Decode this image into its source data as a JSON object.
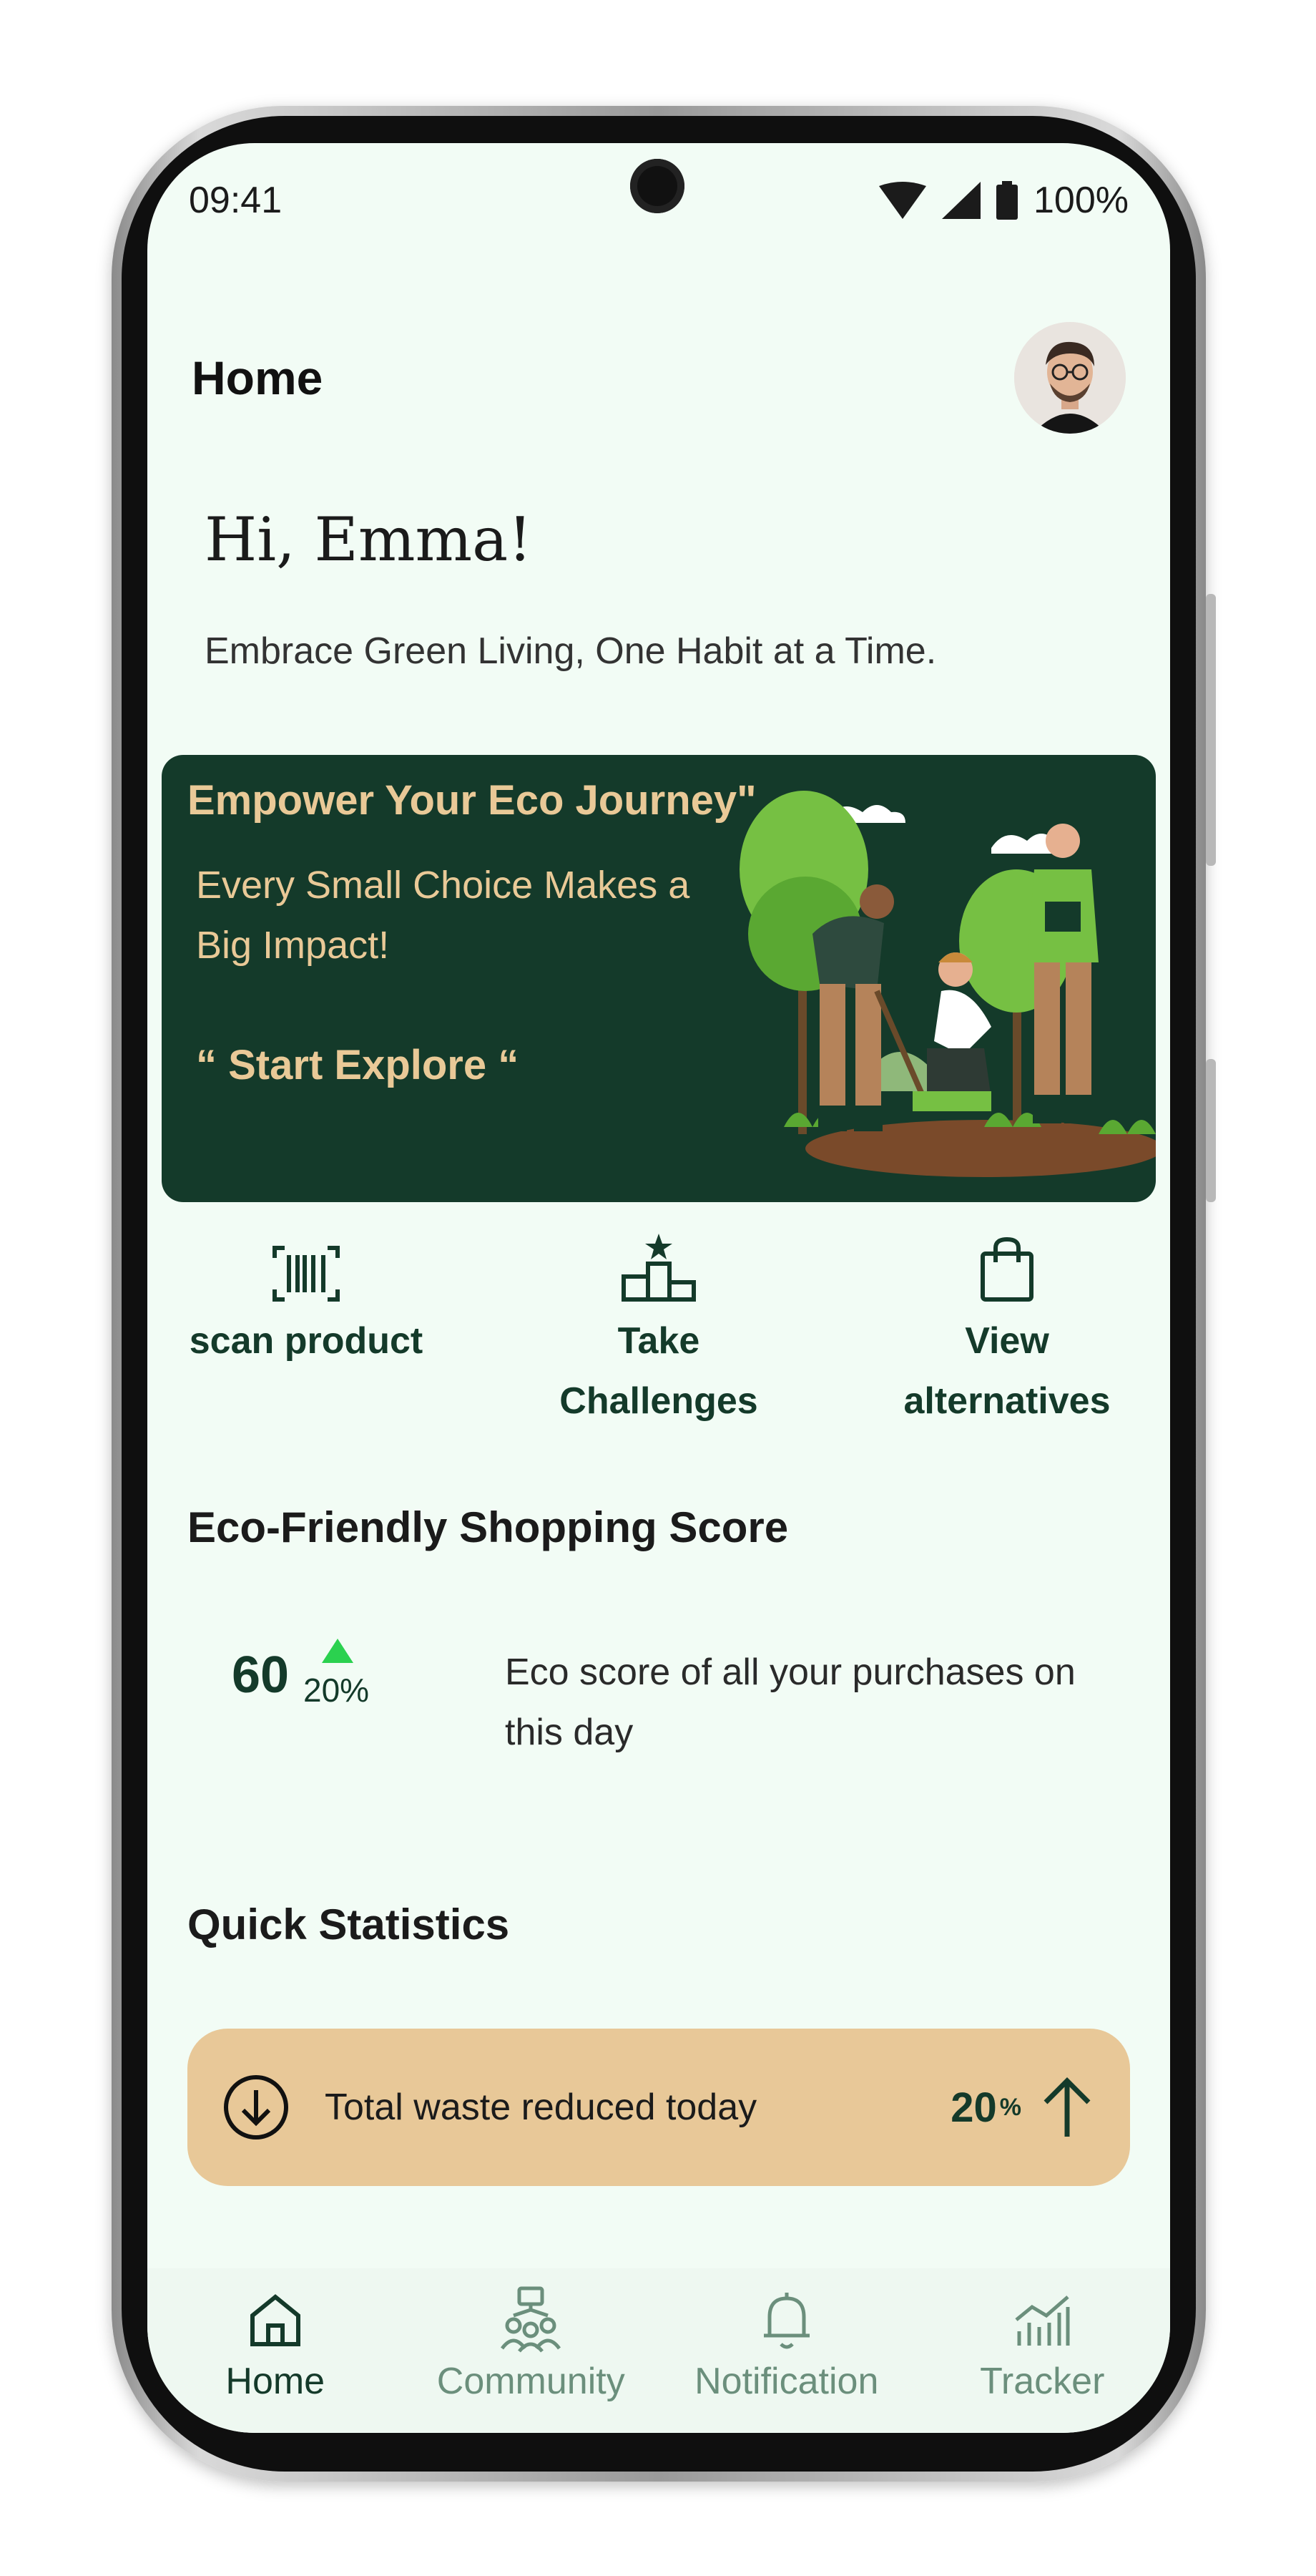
{
  "status_bar": {
    "time": "09:41",
    "battery": "100%"
  },
  "header": {
    "title": "Home"
  },
  "greeting": {
    "text": "Hi, Emma!",
    "tagline": "Embrace Green Living, One Habit at a Time."
  },
  "banner": {
    "title": "Empower Your Eco Journey\"",
    "subtitle": "Every Small Choice Makes a Big Impact!",
    "cta": "“ Start Explore “"
  },
  "quick_actions": [
    {
      "label": "scan product",
      "icon": "barcode-icon"
    },
    {
      "label": "Take Challenges",
      "icon": "podium-icon"
    },
    {
      "label": "View alternatives",
      "icon": "shopping-bag-icon"
    }
  ],
  "score": {
    "title": "Eco-Friendly Shopping Score",
    "value": "60",
    "change": "20%",
    "description": "Eco score of all your purchases on this day"
  },
  "stats": {
    "title": "Quick Statistics",
    "card": {
      "label": "Total waste reduced today",
      "value": "20",
      "unit": "%"
    }
  },
  "nav": [
    {
      "label": "Home",
      "icon": "home-icon",
      "active": true
    },
    {
      "label": "Community",
      "icon": "community-icon"
    },
    {
      "label": "Notification",
      "icon": "bell-icon"
    },
    {
      "label": "Tracker",
      "icon": "chart-icon"
    }
  ],
  "colors": {
    "primary": "#143a2a",
    "accent": "#e9c997",
    "card": "#e8c898",
    "background": "#f2fcf5",
    "up": "#2bd14f"
  }
}
